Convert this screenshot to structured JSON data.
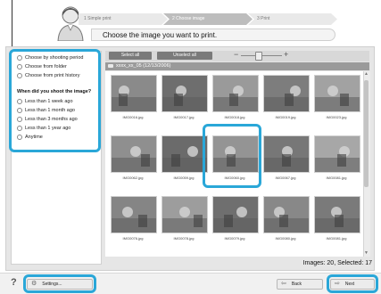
{
  "steps": [
    {
      "label": "1 Simple print",
      "active": false
    },
    {
      "label": "2 Choose image",
      "active": true
    },
    {
      "label": "3 Print",
      "active": false
    }
  ],
  "prompt": "Choose the image you want to print.",
  "view_options": [
    {
      "label": "Choose by shooting period"
    },
    {
      "label": "Choose from folder"
    },
    {
      "label": "Choose from print history"
    }
  ],
  "period_heading": "When did you shoot the image?",
  "period_options": [
    {
      "label": "Less than 1 week ago"
    },
    {
      "label": "Less than 1 month ago"
    },
    {
      "label": "Less than 3 months ago"
    },
    {
      "label": "Less than 1 year ago"
    },
    {
      "label": "Anytime"
    }
  ],
  "toolbar": {
    "select_all": "Select all",
    "unselect_all": "Unselect all",
    "zoom_minus": "−",
    "zoom_plus": "+"
  },
  "folder_label": "xxxx_xx_05 (12/13/2006)",
  "thumbnails": [
    {
      "caption": "IMG0016.jpg",
      "color": "#8a8a8a"
    },
    {
      "caption": "IMG0017.jpg",
      "color": "#6e6e6e"
    },
    {
      "caption": "IMG0018.jpg",
      "color": "#9a9a9a"
    },
    {
      "caption": "IMG0019.jpg",
      "color": "#7d7d7d"
    },
    {
      "caption": "IMG0023.jpg",
      "color": "#a2a2a2"
    },
    {
      "caption": "IMG0062.jpg",
      "color": "#8f8f8f"
    },
    {
      "caption": "IMG0059.jpg",
      "color": "#6b6b6b"
    },
    {
      "caption": "IMG0060.jpg",
      "color": "#949494"
    },
    {
      "caption": "IMG0067.jpg",
      "color": "#777777"
    },
    {
      "caption": "IMG0081.jpg",
      "color": "#a7a7a7"
    },
    {
      "caption": "IMG0076.jpg",
      "color": "#858585"
    },
    {
      "caption": "IMG0078.jpg",
      "color": "#9d9d9d"
    },
    {
      "caption": "IMG0079.jpg",
      "color": "#6f6f6f"
    },
    {
      "caption": "IMG0080.jpg",
      "color": "#888888"
    },
    {
      "caption": "IMG0081.jpg",
      "color": "#7a7a7a"
    }
  ],
  "status": "Images: 20, Selected: 17",
  "footer": {
    "settings": "Settings...",
    "back": "Back",
    "next": "Next"
  },
  "colors": {
    "highlight": "#2aa7d8"
  }
}
